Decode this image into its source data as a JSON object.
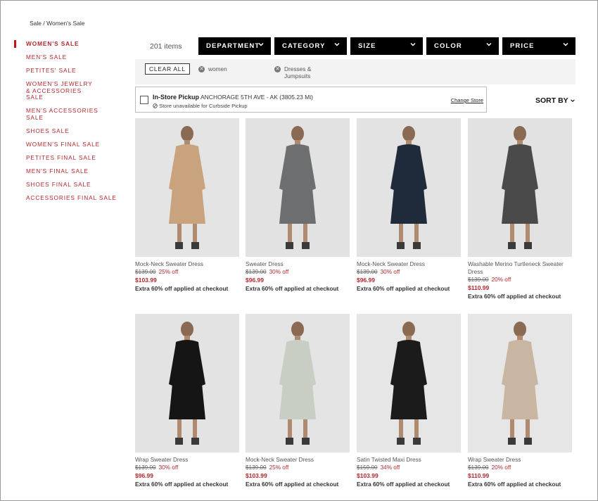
{
  "breadcrumb": {
    "parent": "Sale",
    "separator": " / ",
    "current": "Women's Sale"
  },
  "sidebar": {
    "items": [
      {
        "label": "WOMEN'S SALE",
        "active": true
      },
      {
        "label": "MEN'S SALE"
      },
      {
        "label": "PETITES' SALE"
      },
      {
        "label": "WOMEN'S JEWELRY & ACCESSORIES SALE"
      },
      {
        "label": "MEN'S ACCESSORIES SALE"
      },
      {
        "label": "SHOES SALE"
      },
      {
        "label": "WOMEN'S FINAL SALE"
      },
      {
        "label": "PETITES FINAL SALE"
      },
      {
        "label": "MEN'S FINAL SALE"
      },
      {
        "label": "SHOES FINAL SALE"
      },
      {
        "label": "ACCESSORIES FINAL SALE"
      }
    ]
  },
  "results": {
    "count": "201 items"
  },
  "filters": [
    {
      "label": "DEPARTMENT"
    },
    {
      "label": "CATEGORY"
    },
    {
      "label": "SIZE"
    },
    {
      "label": "COLOR"
    },
    {
      "label": "PRICE"
    }
  ],
  "applied": {
    "clear_all": "CLEAR ALL",
    "chips": [
      {
        "label": "women"
      },
      {
        "label": "Dresses & Jumpsuits"
      }
    ]
  },
  "pickup": {
    "title": "In-Store Pickup",
    "store": "ANCHORAGE 5TH AVE - AK (3805.23 Mi)",
    "unavailable": "Store unavailable for Curbside Pickup",
    "change": "Change Store"
  },
  "sort": {
    "label": "SORT BY"
  },
  "products": [
    {
      "name": "Mock-Neck Sweater Dress",
      "orig": "$139.00",
      "disc": "25% off",
      "sale": "$103.99",
      "extra": "Extra 60% off applied at checkout",
      "garment": "#c9a27e",
      "bg": "#e4e4e4"
    },
    {
      "name": "Sweater Dress",
      "orig": "$139.00",
      "disc": "30% off",
      "sale": "$96.99",
      "extra": "Extra 60% off applied at checkout",
      "garment": "#6d6e70",
      "bg": "#e2e2e2"
    },
    {
      "name": "Mock-Neck Sweater Dress",
      "orig": "$139.00",
      "disc": "30% off",
      "sale": "$96.99",
      "extra": "Extra 60% off applied at checkout",
      "garment": "#1f2a3a",
      "bg": "#e3e3e3"
    },
    {
      "name": "Washable Merino Turtleneck Sweater Dress",
      "orig": "$139.00",
      "disc": "20% off",
      "sale": "$110.99",
      "extra": "Extra 60% off applied at checkout",
      "garment": "#4a4a4a",
      "bg": "#e2e2e2"
    },
    {
      "name": "Wrap Sweater Dress",
      "orig": "$139.00",
      "disc": "30% off",
      "sale": "$96.99",
      "extra": "Extra 60% off applied at checkout",
      "garment": "#151515",
      "bg": "#e3e3e3"
    },
    {
      "name": "Mock-Neck Sweater Dress",
      "orig": "$139.00",
      "disc": "25% off",
      "sale": "$103.99",
      "extra": "Extra 60% off applied at checkout",
      "garment": "#c9cec4",
      "bg": "#e4e4e4"
    },
    {
      "name": "Satin Twisted Maxi Dress",
      "orig": "$159.00",
      "disc": "34% off",
      "sale": "$103.99",
      "extra": "Extra 60% off applied at checkout",
      "garment": "#1b1b1b",
      "bg": "#e6e6e6"
    },
    {
      "name": "Wrap Sweater Dress",
      "orig": "$139.00",
      "disc": "20% off",
      "sale": "$110.99",
      "extra": "Extra 60% off applied at checkout",
      "garment": "#c8b6a3",
      "bg": "#e6e6e6"
    }
  ]
}
